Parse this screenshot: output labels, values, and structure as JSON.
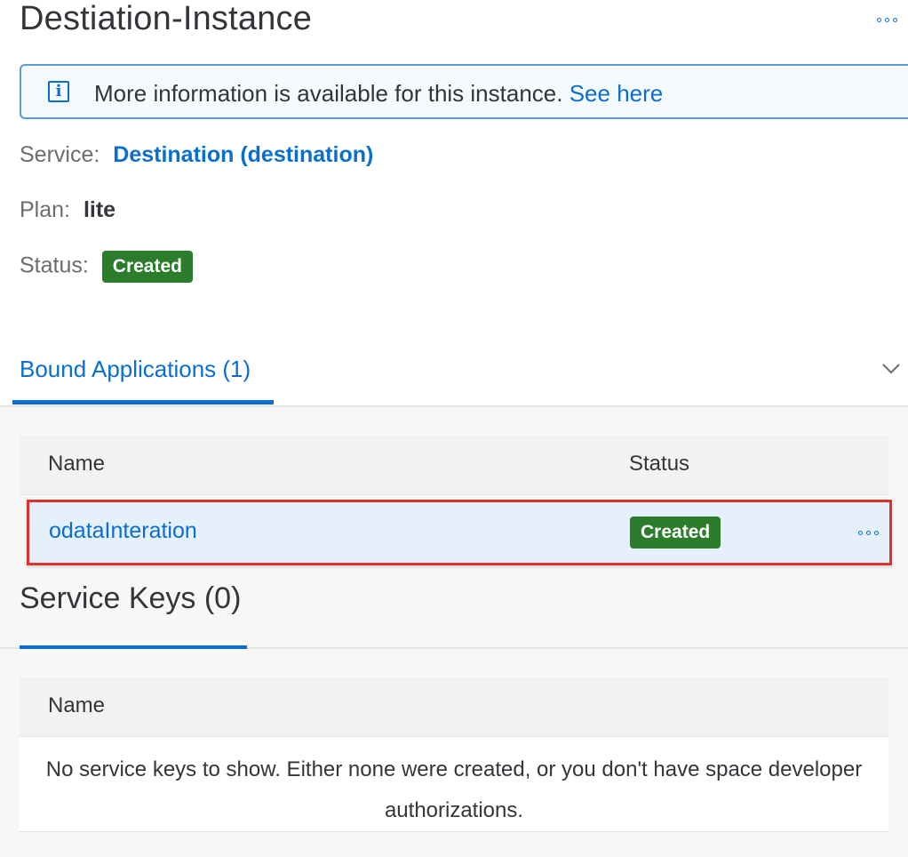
{
  "header": {
    "title": "Destiation-Instance",
    "more_icon": "ellipsis-icon"
  },
  "info_bar": {
    "icon": "info-icon",
    "icon_glyph": "i",
    "text": "More information is available for this instance.",
    "link": "See here"
  },
  "details": {
    "service_label": "Service:",
    "service_value": "Destination (destination)",
    "plan_label": "Plan:",
    "plan_value": "lite",
    "status_label": "Status:",
    "status_value": "Created"
  },
  "bound_applications": {
    "tab_label": "Bound Applications (1)",
    "chevron_icon": "chevron-down-icon",
    "columns": [
      "Name",
      "Status"
    ],
    "rows": [
      {
        "name": "odataInteration",
        "status": "Created"
      }
    ]
  },
  "service_keys": {
    "title": "Service Keys (0)",
    "columns": [
      "Name"
    ],
    "empty_message": "No service keys to show. Either none were created, or you don't have space developer authorizations."
  },
  "colors": {
    "accent": "#0a6ed1",
    "status_created": "#2b7d2b",
    "highlight_border": "#d9342b"
  }
}
